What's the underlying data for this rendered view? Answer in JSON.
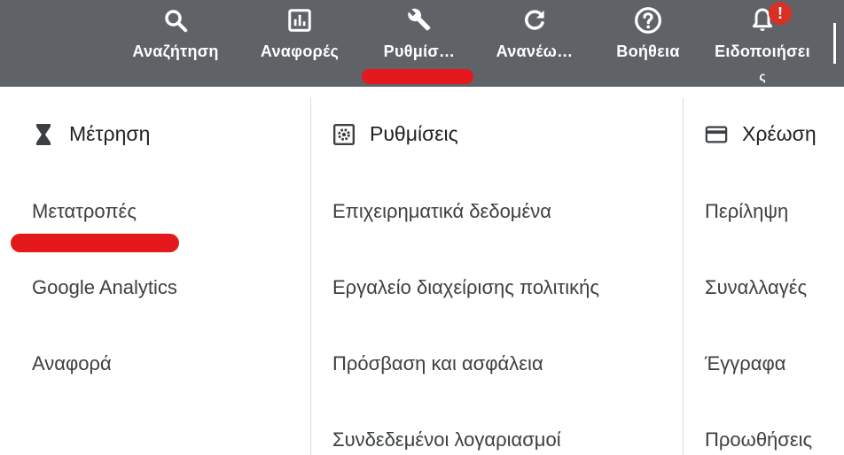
{
  "toolbar": {
    "items": [
      {
        "label": "Αναζήτηση",
        "icon": "search-icon"
      },
      {
        "label": "Αναφορές",
        "icon": "reports-icon"
      },
      {
        "label": "Ρυθμίσ…",
        "icon": "wrench-icon"
      },
      {
        "label": "Ανανέω…",
        "icon": "refresh-icon"
      },
      {
        "label": "Βοήθεια",
        "icon": "help-icon"
      },
      {
        "label": "Ειδοποιήσει",
        "icon": "bell-icon",
        "badge": "!",
        "overflow": "ς"
      }
    ],
    "active_index": 2
  },
  "columns": [
    {
      "heading": "Μέτρηση",
      "icon": "hourglass-icon",
      "items": [
        "Μετατροπές",
        "Google Analytics",
        "Αναφορά"
      ]
    },
    {
      "heading": "Ρυθμίσεις",
      "icon": "settings-icon",
      "items": [
        "Επιχειρηματικά δεδομένα",
        "Εργαλείο διαχείρισης πολιτικής",
        "Πρόσβαση και ασφάλεια",
        "Συνδεδεμένοι λογαριασμοί"
      ]
    },
    {
      "heading": "Χρέωση",
      "icon": "credit-card-icon",
      "items": [
        "Περίληψη",
        "Συναλλαγές",
        "Έγγραφα",
        "Προωθήσεις"
      ]
    }
  ],
  "colors": {
    "toolbar_bg": "#5f6368",
    "annotation_red": "#e3191b",
    "badge_red": "#d93025"
  }
}
